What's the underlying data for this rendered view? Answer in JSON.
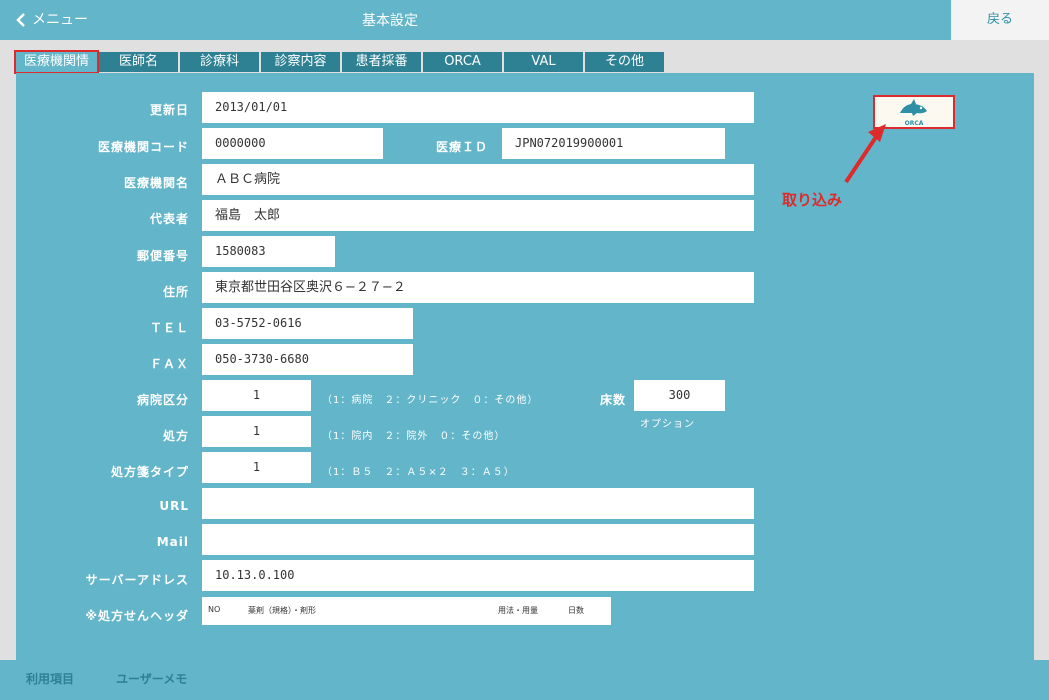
{
  "header": {
    "menu_label": "メニュー",
    "title": "基本設定",
    "back_label": "戻る"
  },
  "tabs": [
    {
      "label": "医療機関情"
    },
    {
      "label": "医師名"
    },
    {
      "label": "診療科"
    },
    {
      "label": "診察内容"
    },
    {
      "label": "患者採番"
    },
    {
      "label": "ORCA"
    },
    {
      "label": "VAL"
    },
    {
      "label": "その他"
    }
  ],
  "form": {
    "update_date": {
      "label": "更新日",
      "value": "2013/01/01"
    },
    "facility_code": {
      "label": "医療機関コード",
      "value": "0000000"
    },
    "medical_id": {
      "label": "医療ＩＤ",
      "value": "JPN072019900001"
    },
    "facility_name": {
      "label": "医療機関名",
      "value": "ＡＢＣ病院"
    },
    "representative": {
      "label": "代表者",
      "value": "福島　太郎"
    },
    "postal_code": {
      "label": "郵便番号",
      "value": "1580083"
    },
    "address": {
      "label": "住所",
      "value": "東京都世田谷区奥沢６−２７−２"
    },
    "tel": {
      "label": "ＴＥＬ",
      "value": "03-5752-0616"
    },
    "fax": {
      "label": "ＦＡＸ",
      "value": "050-3730-6680"
    },
    "hospital_type": {
      "label": "病院区分",
      "value": "1",
      "hint": "（1：病院　２：クリニック　０：その他）"
    },
    "beds": {
      "label": "床数",
      "value": "300",
      "hint": "オプション"
    },
    "prescription": {
      "label": "処方",
      "value": "1",
      "hint": "（1：院内　２：院外　０：その他）"
    },
    "rx_form_type": {
      "label": "処方箋タイプ",
      "value": "1",
      "hint": "（1：Ｂ５　２：Ａ５×２　３：Ａ５）"
    },
    "url": {
      "label": "URL",
      "value": ""
    },
    "mail": {
      "label": "Mail",
      "value": ""
    },
    "server_address": {
      "label": "サーバーアドレス",
      "value": "10.13.0.100"
    },
    "rx_header": {
      "label": "※処方せんヘッダ",
      "columns": [
        "NO",
        "薬剤（規格）・剤形",
        "用法・用量",
        "日数"
      ]
    }
  },
  "orca_import": {
    "logo_text": "ORCA",
    "callout": "取り込み"
  },
  "bottom": {
    "items": [
      "利用項目",
      "ユーザーメモ"
    ]
  },
  "colors": {
    "panel": "#63b5ca",
    "tab": "#2e8193",
    "highlight": "#dd2b2b"
  }
}
